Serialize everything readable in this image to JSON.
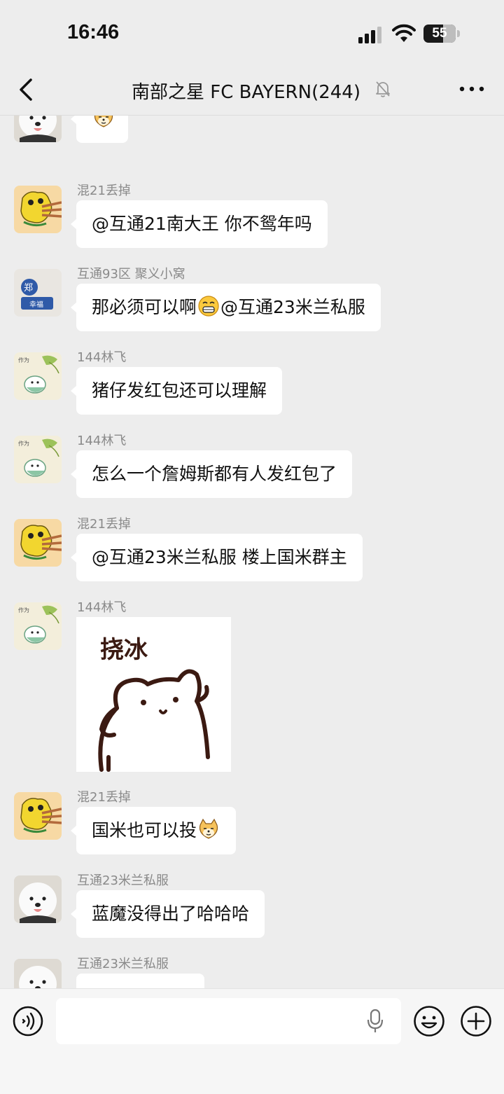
{
  "status_bar": {
    "time": "16:46",
    "battery": "55"
  },
  "nav": {
    "title": "南部之星 FC BAYERN(244)",
    "muted": true
  },
  "messages": [
    {
      "sender": "",
      "type": "emoji",
      "avatar": "samoyed"
    },
    {
      "sender": "混21丢掉",
      "type": "text",
      "text": "@互通21南大王 你不鸳年吗",
      "avatar": "yellow-cartoon"
    },
    {
      "sender": "互通93区 聚义小窝",
      "type": "text",
      "text_before": "那必须可以啊",
      "emoji": "grin",
      "text_after": "@互通23米兰私服",
      "avatar": "zheng-doll"
    },
    {
      "sender": "144林飞",
      "type": "text",
      "text": "猪仔发红包还可以理解",
      "avatar": "green-cat"
    },
    {
      "sender": "144林飞",
      "type": "text",
      "text": "怎么一个詹姆斯都有人发红包了",
      "avatar": "green-cat"
    },
    {
      "sender": "混21丢掉",
      "type": "text",
      "text": "@互通23米兰私服 楼上国米群主",
      "avatar": "yellow-cartoon"
    },
    {
      "sender": "144林飞",
      "type": "sticker",
      "sticker_text": "挠冰",
      "avatar": "green-cat"
    },
    {
      "sender": "混21丢掉",
      "type": "text",
      "text_before": "国米也可以投",
      "emoji": "doge",
      "text_after": "",
      "avatar": "yellow-cartoon"
    },
    {
      "sender": "互通23米兰私服",
      "type": "text",
      "text": "蓝魔没得出了哈哈哈",
      "avatar": "samoyed"
    },
    {
      "sender": "互通23米兰私服",
      "type": "text",
      "text": "",
      "avatar": "samoyed"
    }
  ],
  "input": {
    "placeholder": ""
  },
  "colors": {
    "background": "#ededed",
    "bubble": "#ffffff",
    "sender": "#8a8a8a"
  }
}
